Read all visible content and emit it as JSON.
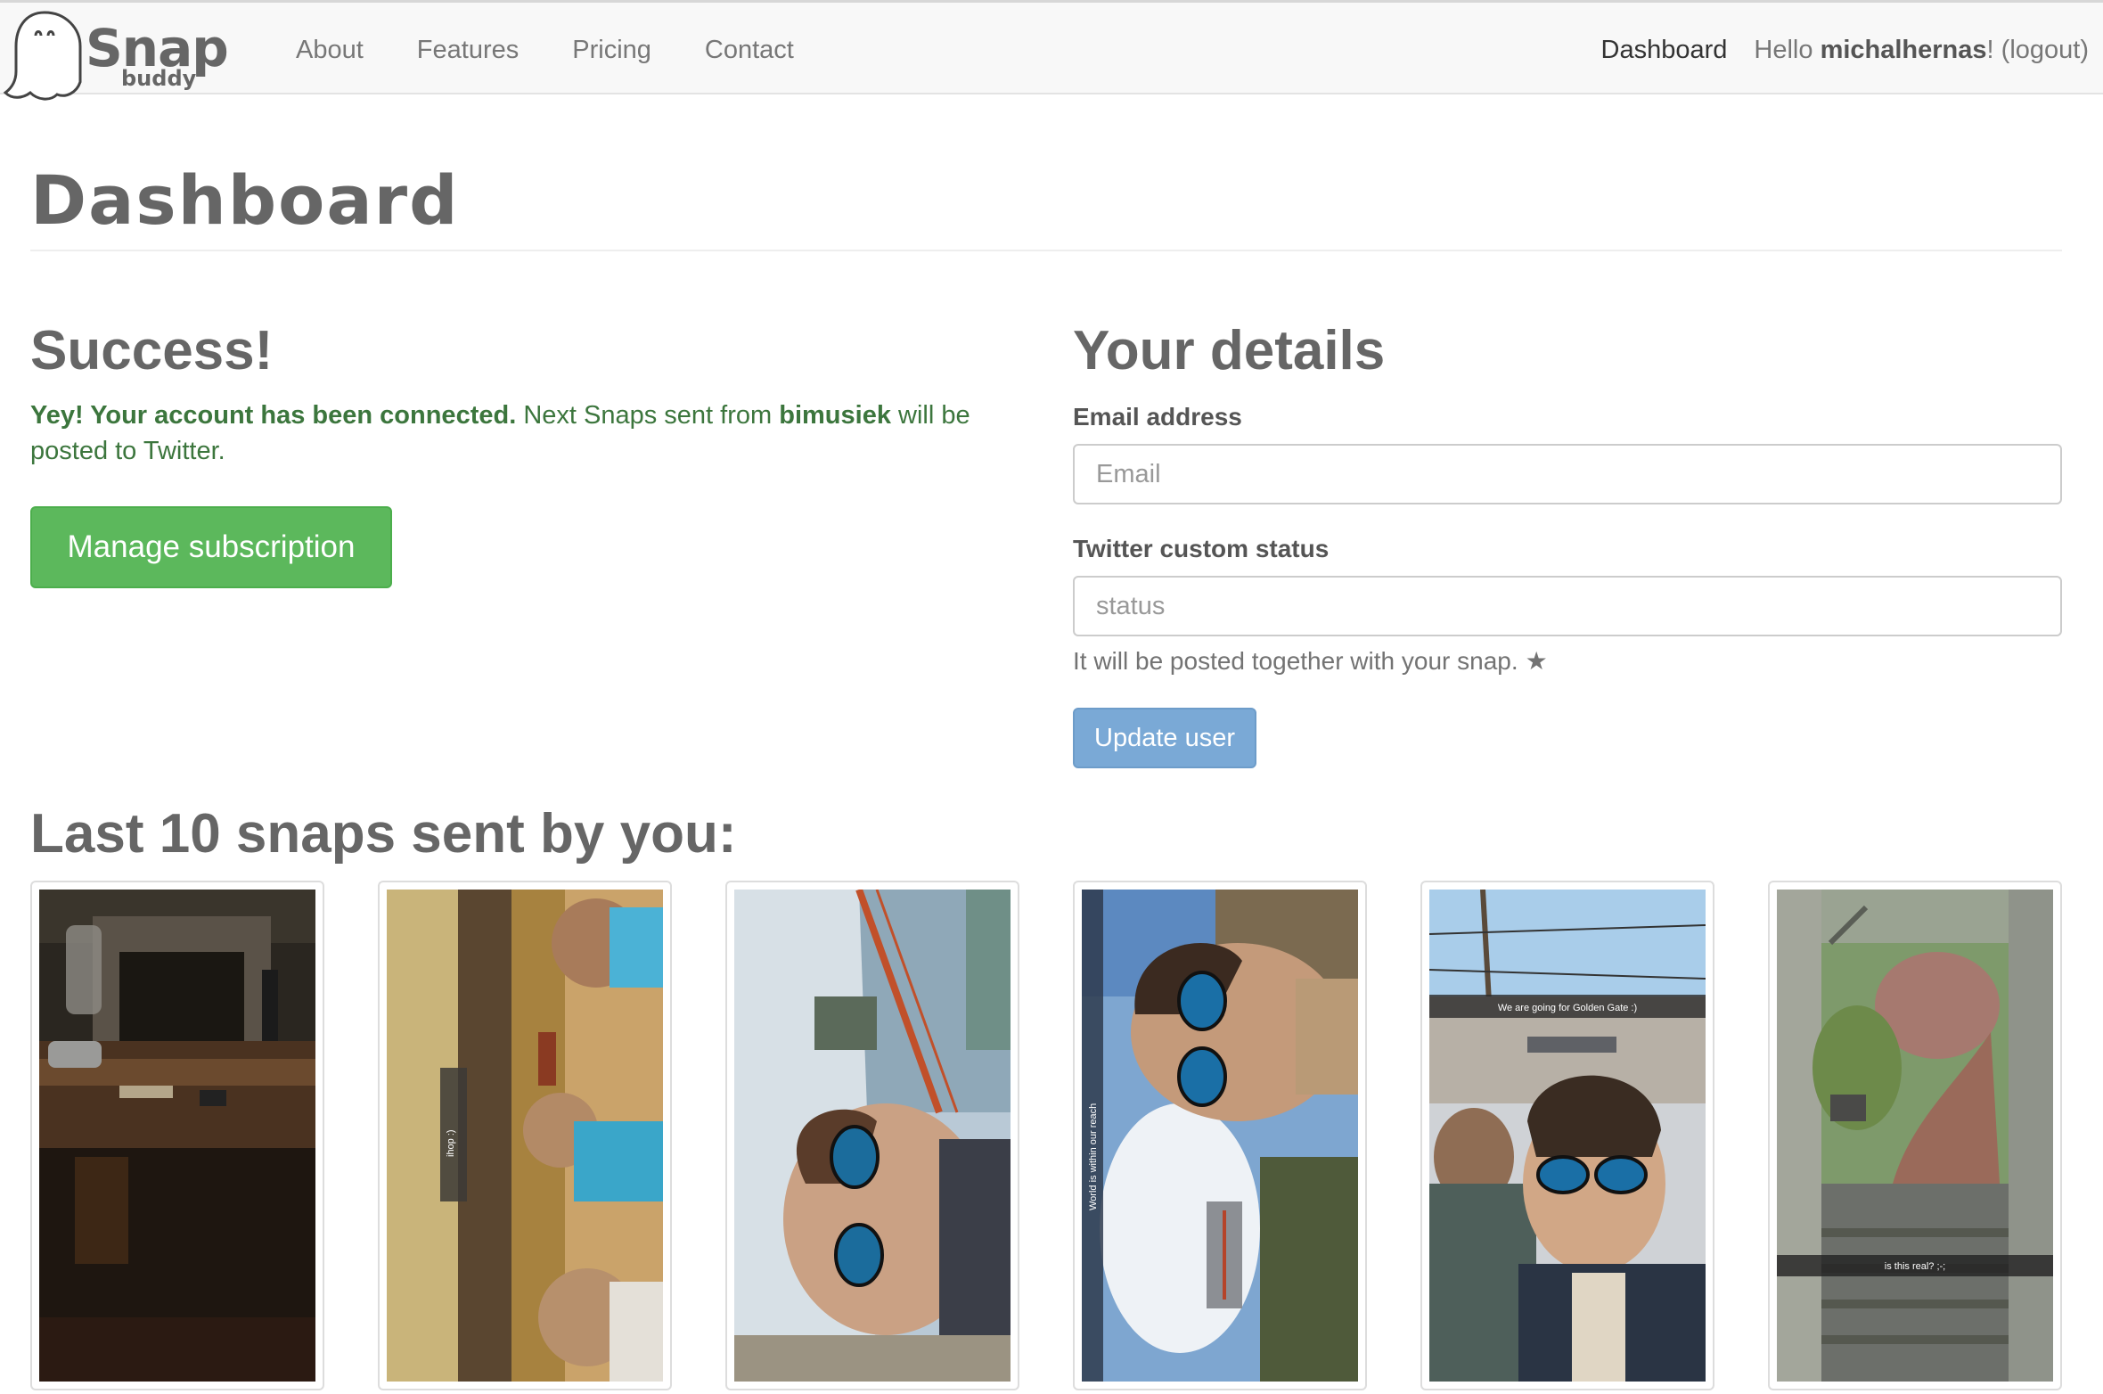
{
  "nav": {
    "brand_main": "Snap",
    "brand_sub": "buddy",
    "links": [
      "About",
      "Features",
      "Pricing",
      "Contact"
    ],
    "dashboard": "Dashboard",
    "hello_prefix": "Hello ",
    "username": "michalhernas",
    "hello_suffix": "! ",
    "logout": "(logout)"
  },
  "page": {
    "title": "Dashboard"
  },
  "success": {
    "title": "Success!",
    "msg_bold": "Yey! Your account has been connected.",
    "msg_part1": "  Next Snaps sent from ",
    "account": "bimusiek",
    "msg_part2": "  will be posted to Twitter.",
    "manage_button": "Manage subscription"
  },
  "details": {
    "title": "Your details",
    "email_label": "Email address",
    "email_placeholder": "Email",
    "email_value": "",
    "status_label": "Twitter custom status",
    "status_placeholder": "status",
    "status_value": "",
    "help_text": "It will be posted together with your snap.",
    "help_icon": "star-icon",
    "update_button": "Update user"
  },
  "snaps": {
    "title": "Last 10 snaps sent by you:",
    "items": [
      {
        "caption": "",
        "desc": "dark room with fireplace and table"
      },
      {
        "caption": "ihop :)",
        "desc": "restaurant selfie group"
      },
      {
        "caption": "",
        "desc": "selfie at golden gate bridge"
      },
      {
        "caption": "World is within our reach",
        "desc": "selfie with bay view"
      },
      {
        "caption": "We are going for Golden Gate :)",
        "desc": "two friends selfie on street"
      },
      {
        "caption": "is this real? ;-;",
        "desc": "wet stairs and garden"
      }
    ]
  },
  "colors": {
    "success_text": "#3c763d",
    "success_button": "#5cb85c",
    "primary_button": "#7aa9d6",
    "navbar_bg": "#f8f8f8"
  }
}
